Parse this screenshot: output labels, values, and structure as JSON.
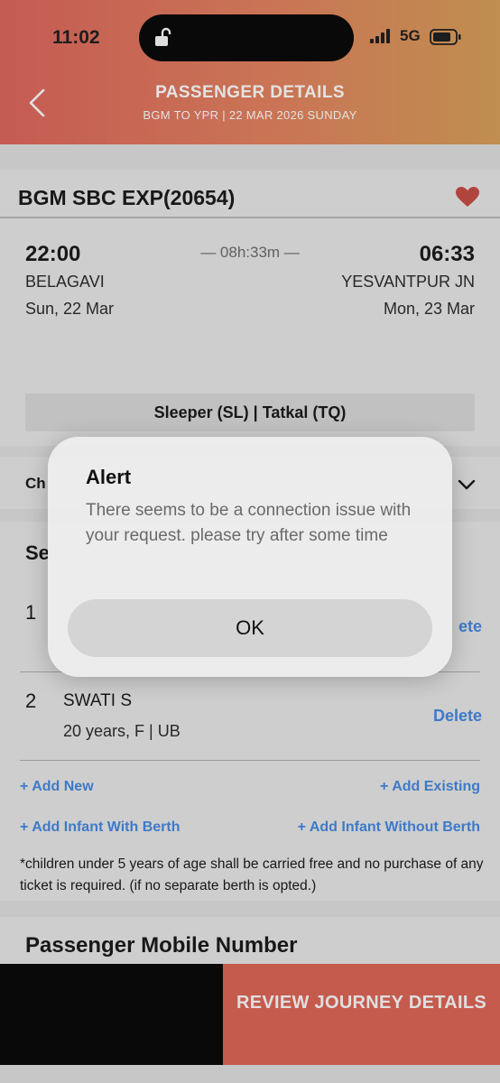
{
  "status_bar": {
    "time": "11:02",
    "network": "5G"
  },
  "header": {
    "title": "PASSENGER DETAILS",
    "subtitle": "BGM TO YPR | 22 MAR 2026 SUNDAY"
  },
  "train": {
    "name": "BGM SBC EXP(20654)",
    "departure_time": "22:00",
    "arrival_time": "06:33",
    "duration": "— 08h:33m —",
    "departure_station": "BELAGAVI",
    "arrival_station": "YESVANTPUR JN",
    "departure_date": "Sun, 22 Mar",
    "arrival_date": "Mon, 23 Mar",
    "class_quota": "Sleeper (SL) | Tatkal (TQ)"
  },
  "choose_row": {
    "label": "Ch"
  },
  "passengers_section": {
    "title": "Se",
    "passengers": [
      {
        "num": "1",
        "name": "",
        "details": "",
        "delete": "ete"
      },
      {
        "num": "2",
        "name": "SWATI S",
        "details": "20 years, F | UB",
        "delete": "Delete"
      }
    ],
    "add_new": "+ Add New",
    "add_existing": "+ Add Existing",
    "add_infant_with_berth": "+ Add Infant With Berth",
    "add_infant_without_berth": "+ Add Infant Without Berth",
    "note": "*children under 5 years of age shall be carried free and no purchase of any ticket is required. (if no separate berth is opted.)"
  },
  "mobile_section": {
    "title": "Passenger Mobile Number"
  },
  "footer": {
    "review_button": "REVIEW JOURNEY DETAILS"
  },
  "alert": {
    "title": "Alert",
    "message": "There seems to be a connection issue with your request. please try after some time",
    "ok_label": "OK"
  },
  "colors": {
    "header_start": "#cd5a52",
    "header_end": "#c6914e",
    "link_blue": "#3a7bd0",
    "heart_red": "#b8403a",
    "review_button": "#cd5a4a"
  }
}
